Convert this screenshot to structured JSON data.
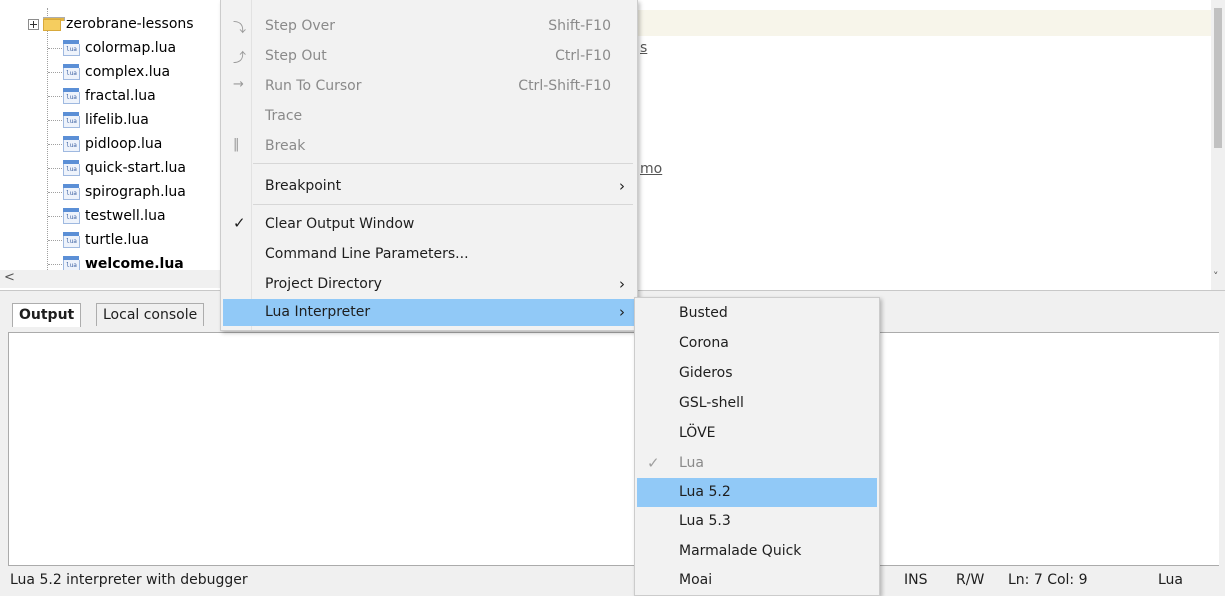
{
  "project_tree": {
    "folder": "zerobrane-lessons",
    "files": [
      {
        "label": "colormap.lua",
        "icon": "lua-file-icon"
      },
      {
        "label": "complex.lua",
        "icon": "lua-file-icon"
      },
      {
        "label": "fractal.lua",
        "icon": "lua-file-icon"
      },
      {
        "label": "lifelib.lua",
        "icon": "lua-file-icon"
      },
      {
        "label": "pidloop.lua",
        "icon": "lua-file-icon"
      },
      {
        "label": "quick-start.lua",
        "icon": "lua-file-icon"
      },
      {
        "label": "spirograph.lua",
        "icon": "lua-file-icon"
      },
      {
        "label": "testwell.lua",
        "icon": "lua-file-icon"
      },
      {
        "label": "turtle.lua",
        "icon": "lua-file-icon"
      },
      {
        "label": "welcome.lua",
        "icon": "lua-file-icon"
      }
    ],
    "file_icon_text": "lua",
    "scroll_left_glyph": "<"
  },
  "editor": {
    "fragments": [
      "s",
      "mo"
    ],
    "scroll_down_glyph": "˅"
  },
  "menu": {
    "items": [
      {
        "label": "Step Over",
        "shortcut": "Shift-F10",
        "icon": "step-over-icon",
        "icon_glyph": "⤵"
      },
      {
        "label": "Step Out",
        "shortcut": "Ctrl-F10",
        "icon": "step-out-icon",
        "icon_glyph": "⤴"
      },
      {
        "label": "Run To Cursor",
        "shortcut": "Ctrl-Shift-F10",
        "icon": "run-to-cursor-icon",
        "icon_glyph": "→"
      },
      {
        "label": "Trace",
        "shortcut": ""
      },
      {
        "label": "Break",
        "shortcut": "",
        "icon": "break-icon",
        "icon_glyph": "‖"
      },
      {
        "label": "Breakpoint",
        "submenu": true
      },
      {
        "label": "Clear Output Window",
        "checked": true
      },
      {
        "label": "Command Line Parameters..."
      },
      {
        "label": "Project Directory",
        "submenu": true
      },
      {
        "label": "Lua Interpreter",
        "submenu": true,
        "highlighted": true
      }
    ],
    "chevron": "›",
    "check_glyph": "✓"
  },
  "interpreter_submenu": {
    "items": [
      "Busted",
      "Corona",
      "Gideros",
      "GSL-shell",
      "LÖVE",
      "Lua",
      "Lua 5.2",
      "Lua 5.3",
      "Marmalade Quick",
      "Moai"
    ],
    "checked": "Lua",
    "highlighted": "Lua 5.2"
  },
  "bottom_tabs": [
    "Output",
    "Local console"
  ],
  "status_bar": {
    "message": "Lua 5.2 interpreter with debugger",
    "mode": "INS",
    "access": "R/W",
    "position": "Ln: 7 Col: 9",
    "language": "Lua"
  },
  "colors": {
    "highlight": "#91c9f7",
    "menu_bg": "#f2f2f2",
    "folder": "#f5cd5f",
    "lua_icon": "#5b8fd6"
  }
}
